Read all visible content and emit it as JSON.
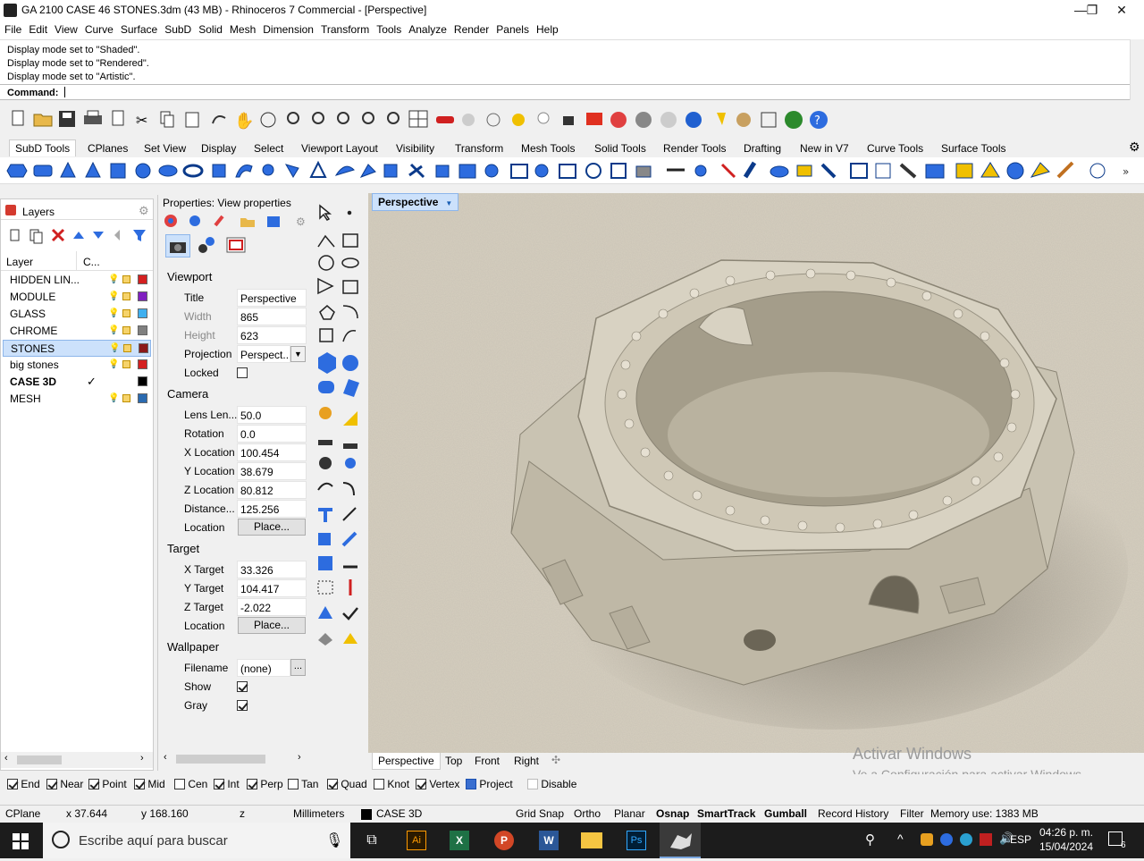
{
  "window": {
    "title": "GA 2100 CASE 46 STONES.3dm (43 MB) - Rhinoceros 7 Commercial - [Perspective]"
  },
  "menu": [
    "File",
    "Edit",
    "View",
    "Curve",
    "Surface",
    "SubD",
    "Solid",
    "Mesh",
    "Dimension",
    "Transform",
    "Tools",
    "Analyze",
    "Render",
    "Panels",
    "Help"
  ],
  "command": {
    "history": [
      "Display mode set to \"Shaded\".",
      "Display mode set to \"Rendered\".",
      "Display mode set to \"Artistic\"."
    ],
    "prompt": "Command:"
  },
  "tabs": [
    "SubD Tools",
    "CPlanes",
    "Set View",
    "Display",
    "Select",
    "Viewport Layout",
    "Visibility",
    "Transform",
    "Mesh Tools",
    "Solid Tools",
    "Render Tools",
    "Drafting",
    "New in V7",
    "Curve Tools",
    "Surface Tools"
  ],
  "layers": {
    "title": "Layers",
    "col_layer": "Layer",
    "col_c": "C...",
    "rows": [
      {
        "name": "HIDDEN LIN...",
        "color": "#d42020"
      },
      {
        "name": "MODULE",
        "color": "#8020c0"
      },
      {
        "name": "GLASS",
        "color": "#40b0f0"
      },
      {
        "name": "CHROME",
        "color": "#808080"
      },
      {
        "name": "STONES",
        "color": "#8b1a1a"
      },
      {
        "name": "big stones",
        "color": "#d42020"
      },
      {
        "name": "CASE 3D",
        "color": "#000000"
      },
      {
        "name": "MESH",
        "color": "#2a6ab0"
      }
    ]
  },
  "props": {
    "title": "Properties: View properties",
    "viewport": "Viewport",
    "camera": "Camera",
    "target": "Target",
    "wallpaper": "Wallpaper",
    "title_lbl": "Title",
    "title_val": "Perspective",
    "width_lbl": "Width",
    "width_val": "865",
    "height_lbl": "Height",
    "height_val": "623",
    "proj_lbl": "Projection",
    "proj_val": "Perspect...",
    "locked_lbl": "Locked",
    "lens_lbl": "Lens Len...",
    "lens_val": "50.0",
    "rot_lbl": "Rotation",
    "rot_val": "0.0",
    "xloc_lbl": "X Location",
    "xloc_val": "100.454",
    "yloc_lbl": "Y Location",
    "yloc_val": "38.679",
    "zloc_lbl": "Z Location",
    "zloc_val": "80.812",
    "dist_lbl": "Distance...",
    "dist_val": "125.256",
    "loc_lbl": "Location",
    "place": "Place...",
    "xt_lbl": "X Target",
    "xt_val": "33.326",
    "yt_lbl": "Y Target",
    "yt_val": "104.417",
    "zt_lbl": "Z Target",
    "zt_val": "-2.022",
    "fn_lbl": "Filename",
    "fn_val": "(none)",
    "ellipsis": "...",
    "show_lbl": "Show",
    "gray_lbl": "Gray"
  },
  "viewport": {
    "label": "Perspective",
    "tabs": [
      "Perspective",
      "Top",
      "Front",
      "Right"
    ],
    "watermark1": "Activar Windows",
    "watermark2": "Ve a Configuración para activar Windows."
  },
  "osnap": [
    "End",
    "Near",
    "Point",
    "Mid",
    "Cen",
    "Int",
    "Perp",
    "Tan",
    "Quad",
    "Knot",
    "Vertex",
    "Project",
    "Disable"
  ],
  "status": {
    "cplane": "CPlane",
    "x": "x 37.644",
    "y": "y 168.160",
    "z": "z",
    "units": "Millimeters",
    "layer": "CASE 3D",
    "gridsnap": "Grid Snap",
    "ortho": "Ortho",
    "planar": "Planar",
    "osnap": "Osnap",
    "smarttrack": "SmartTrack",
    "gumball": "Gumball",
    "record": "Record History",
    "filter": "Filter",
    "memory": "Memory use: 1383 MB"
  },
  "taskbar": {
    "search": "Escribe aquí para buscar",
    "lang": "ESP",
    "time": "04:26 p. m.",
    "date": "15/04/2024",
    "notif": "6"
  }
}
